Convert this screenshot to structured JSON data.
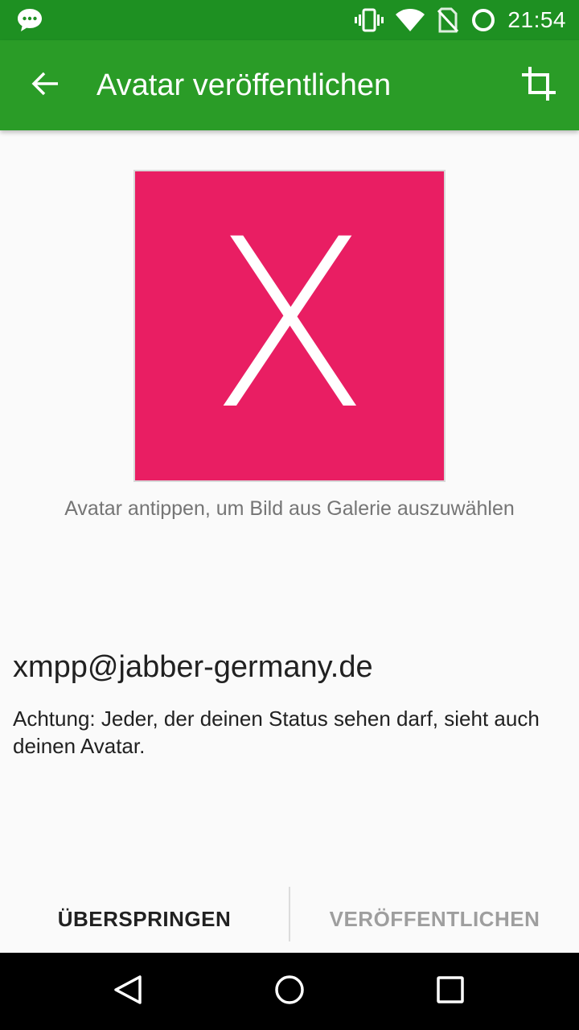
{
  "status_bar": {
    "time": "21:54",
    "icons": [
      "chat-notification-icon",
      "vibrate-icon",
      "wifi-icon",
      "no-sim-icon",
      "battery-ring-icon"
    ]
  },
  "app_bar": {
    "title": "Avatar veröffentlichen",
    "back_icon": "arrow-back-icon",
    "crop_icon": "crop-icon",
    "color": "#2a9c27"
  },
  "avatar": {
    "letter": "X",
    "background_color": "#e91e63"
  },
  "hint": "Avatar antippen, um Bild aus Galerie auszuwählen",
  "account": "xmpp@jabber-germany.de",
  "warning": "Achtung: Jeder, der deinen Status sehen darf, sieht auch deinen Avatar.",
  "buttons": {
    "skip": "ÜBERSPRINGEN",
    "publish": "VERÖFFENTLICHEN"
  },
  "nav_bar": {
    "icons": [
      "nav-back-icon",
      "nav-home-icon",
      "nav-recents-icon"
    ]
  }
}
